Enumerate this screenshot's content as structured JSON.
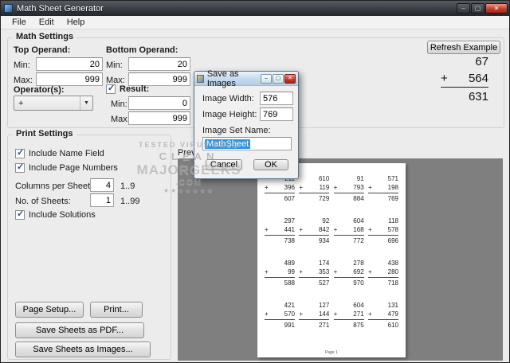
{
  "window": {
    "title": "Math Sheet Generator",
    "menu": [
      "File",
      "Edit",
      "Help"
    ]
  },
  "math_settings": {
    "label": "Math Settings",
    "top_operand": {
      "label": "Top Operand:",
      "min_label": "Min:",
      "min": "20",
      "max_label": "Max:",
      "max": "999"
    },
    "bottom_operand": {
      "label": "Bottom Operand:",
      "min_label": "Min:",
      "min": "20",
      "max_label": "Max:",
      "max": "999"
    },
    "operators": {
      "label": "Operator(s):",
      "value": "+"
    },
    "result": {
      "label": "Result:",
      "min_label": "Min:",
      "min": "0",
      "max_label": "Max:",
      "max": "999"
    },
    "refresh_button": "Refresh Example",
    "example": {
      "top": "67",
      "plus": "+",
      "bottom": "564",
      "result": "631"
    }
  },
  "print_settings": {
    "label": "Print Settings",
    "include_name_field": "Include Name Field",
    "include_page_numbers": "Include Page Numbers",
    "columns_per_sheet": {
      "label": "Columns per Sheet:",
      "value": "4",
      "range": "1..9"
    },
    "no_of_sheets": {
      "label": "No. of Sheets:",
      "value": "1",
      "range": "1..99"
    },
    "include_solutions": "Include Solutions",
    "page_setup_button": "Page Setup...",
    "print_button": "Print...",
    "save_pdf_button": "Save Sheets as PDF...",
    "save_images_button": "Save Sheets as Images..."
  },
  "preview": {
    "label": "Preview:",
    "page_label": "Page 1",
    "problems": [
      {
        "top": "211",
        "bottom": "396",
        "result": "607"
      },
      {
        "top": "610",
        "bottom": "119",
        "result": "729"
      },
      {
        "top": "91",
        "bottom": "793",
        "result": "884"
      },
      {
        "top": "571",
        "bottom": "198",
        "result": "769"
      },
      {
        "top": "297",
        "bottom": "441",
        "result": "738"
      },
      {
        "top": "92",
        "bottom": "842",
        "result": "934"
      },
      {
        "top": "604",
        "bottom": "168",
        "result": "772"
      },
      {
        "top": "118",
        "bottom": "578",
        "result": "696"
      },
      {
        "top": "489",
        "bottom": "99",
        "result": "588"
      },
      {
        "top": "174",
        "bottom": "353",
        "result": "527"
      },
      {
        "top": "278",
        "bottom": "692",
        "result": "970"
      },
      {
        "top": "438",
        "bottom": "280",
        "result": "718"
      },
      {
        "top": "421",
        "bottom": "570",
        "result": "991"
      },
      {
        "top": "127",
        "bottom": "144",
        "result": "271"
      },
      {
        "top": "604",
        "bottom": "271",
        "result": "875"
      },
      {
        "top": "131",
        "bottom": "479",
        "result": "610"
      }
    ]
  },
  "dialog": {
    "title": "Save as Images",
    "width_label": "Image Width:",
    "width_value": "576",
    "height_label": "Image Height:",
    "height_value": "769",
    "name_label": "Image Set Name:",
    "name_value": "MathSheet",
    "cancel_button": "Cancel",
    "ok_button": "OK"
  },
  "watermark": {
    "line1": "TESTED VIRUS FREE",
    "line2": "CLEAN",
    "line3": "MAJORGEEKS",
    "line4": ".COM",
    "line5": "★★★★★★★"
  }
}
